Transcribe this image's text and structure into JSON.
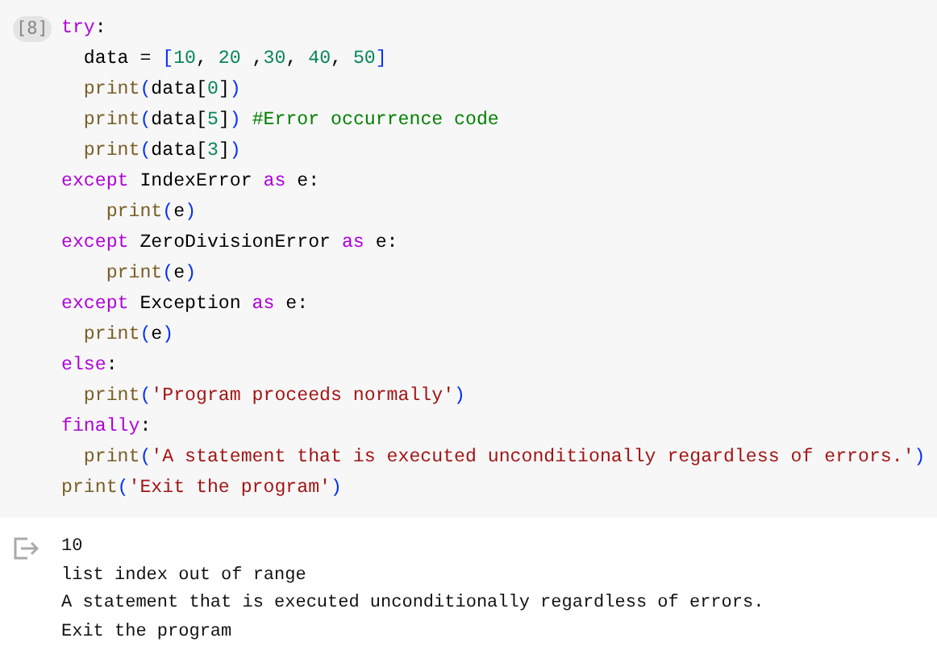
{
  "code_cell": {
    "execution_count": "[8]",
    "lines": [
      {
        "kind": "top",
        "tokens": [
          {
            "kind": "keyword",
            "text": "try"
          },
          {
            "kind": "plain",
            "text": ":"
          }
        ]
      },
      {
        "kind": "body",
        "tokens": [
          {
            "kind": "plain",
            "text": "data = "
          },
          {
            "kind": "bracket",
            "text": "["
          },
          {
            "kind": "number",
            "text": "10"
          },
          {
            "kind": "plain",
            "text": ", "
          },
          {
            "kind": "number",
            "text": "20"
          },
          {
            "kind": "plain",
            "text": " ,"
          },
          {
            "kind": "number",
            "text": "30"
          },
          {
            "kind": "plain",
            "text": ", "
          },
          {
            "kind": "number",
            "text": "40"
          },
          {
            "kind": "plain",
            "text": ", "
          },
          {
            "kind": "number",
            "text": "50"
          },
          {
            "kind": "bracket",
            "text": "]"
          }
        ]
      },
      {
        "kind": "body",
        "tokens": [
          {
            "kind": "builtin",
            "text": "print"
          },
          {
            "kind": "bracket",
            "text": "("
          },
          {
            "kind": "plain",
            "text": "data["
          },
          {
            "kind": "number",
            "text": "0"
          },
          {
            "kind": "plain",
            "text": "]"
          },
          {
            "kind": "bracket",
            "text": ")"
          }
        ]
      },
      {
        "kind": "body",
        "tokens": [
          {
            "kind": "builtin",
            "text": "print"
          },
          {
            "kind": "bracket",
            "text": "("
          },
          {
            "kind": "plain",
            "text": "data["
          },
          {
            "kind": "number",
            "text": "5"
          },
          {
            "kind": "plain",
            "text": "]"
          },
          {
            "kind": "bracket",
            "text": ") "
          },
          {
            "kind": "comment",
            "text": "#Error occurrence code"
          }
        ]
      },
      {
        "kind": "body",
        "tokens": [
          {
            "kind": "builtin",
            "text": "print"
          },
          {
            "kind": "bracket",
            "text": "("
          },
          {
            "kind": "plain",
            "text": "data["
          },
          {
            "kind": "number",
            "text": "3"
          },
          {
            "kind": "plain",
            "text": "]"
          },
          {
            "kind": "bracket",
            "text": ")"
          }
        ]
      },
      {
        "kind": "top",
        "tokens": [
          {
            "kind": "keyword",
            "text": "except"
          },
          {
            "kind": "plain",
            "text": " IndexError "
          },
          {
            "kind": "keyword",
            "text": "as"
          },
          {
            "kind": "plain",
            "text": " e:"
          }
        ]
      },
      {
        "kind": "deep",
        "tokens": [
          {
            "kind": "builtin",
            "text": "print"
          },
          {
            "kind": "bracket",
            "text": "("
          },
          {
            "kind": "plain",
            "text": "e"
          },
          {
            "kind": "bracket",
            "text": ")"
          }
        ]
      },
      {
        "kind": "top",
        "tokens": [
          {
            "kind": "keyword",
            "text": "except"
          },
          {
            "kind": "plain",
            "text": " ZeroDivisionError "
          },
          {
            "kind": "keyword",
            "text": "as"
          },
          {
            "kind": "plain",
            "text": " e:"
          }
        ]
      },
      {
        "kind": "deep",
        "tokens": [
          {
            "kind": "builtin",
            "text": "print"
          },
          {
            "kind": "bracket",
            "text": "("
          },
          {
            "kind": "plain",
            "text": "e"
          },
          {
            "kind": "bracket",
            "text": ")"
          }
        ]
      },
      {
        "kind": "top",
        "tokens": [
          {
            "kind": "keyword",
            "text": "except"
          },
          {
            "kind": "plain",
            "text": " Exception "
          },
          {
            "kind": "keyword",
            "text": "as"
          },
          {
            "kind": "plain",
            "text": " e:"
          }
        ]
      },
      {
        "kind": "body",
        "tokens": [
          {
            "kind": "builtin",
            "text": "print"
          },
          {
            "kind": "bracket",
            "text": "("
          },
          {
            "kind": "plain",
            "text": "e"
          },
          {
            "kind": "bracket",
            "text": ")"
          }
        ]
      },
      {
        "kind": "top",
        "tokens": [
          {
            "kind": "keyword",
            "text": "else"
          },
          {
            "kind": "plain",
            "text": ":"
          }
        ]
      },
      {
        "kind": "body",
        "tokens": [
          {
            "kind": "builtin",
            "text": "print"
          },
          {
            "kind": "bracket",
            "text": "("
          },
          {
            "kind": "string",
            "text": "'Program proceeds normally'"
          },
          {
            "kind": "bracket",
            "text": ")"
          }
        ]
      },
      {
        "kind": "top",
        "tokens": [
          {
            "kind": "keyword",
            "text": "finally"
          },
          {
            "kind": "plain",
            "text": ":"
          }
        ]
      },
      {
        "kind": "body",
        "tokens": [
          {
            "kind": "builtin",
            "text": "print"
          },
          {
            "kind": "bracket",
            "text": "("
          },
          {
            "kind": "string",
            "text": "'A statement that is executed unconditionally regardless of errors.'"
          },
          {
            "kind": "bracket",
            "text": ")"
          }
        ]
      },
      {
        "kind": "top",
        "tokens": [
          {
            "kind": "builtin",
            "text": "print"
          },
          {
            "kind": "bracket",
            "text": "("
          },
          {
            "kind": "string",
            "text": "'Exit the program'"
          },
          {
            "kind": "bracket",
            "text": ")"
          }
        ]
      }
    ]
  },
  "output": {
    "lines": [
      "10",
      "list index out of range",
      "A statement that is executed unconditionally regardless of errors.",
      "Exit the program"
    ]
  }
}
